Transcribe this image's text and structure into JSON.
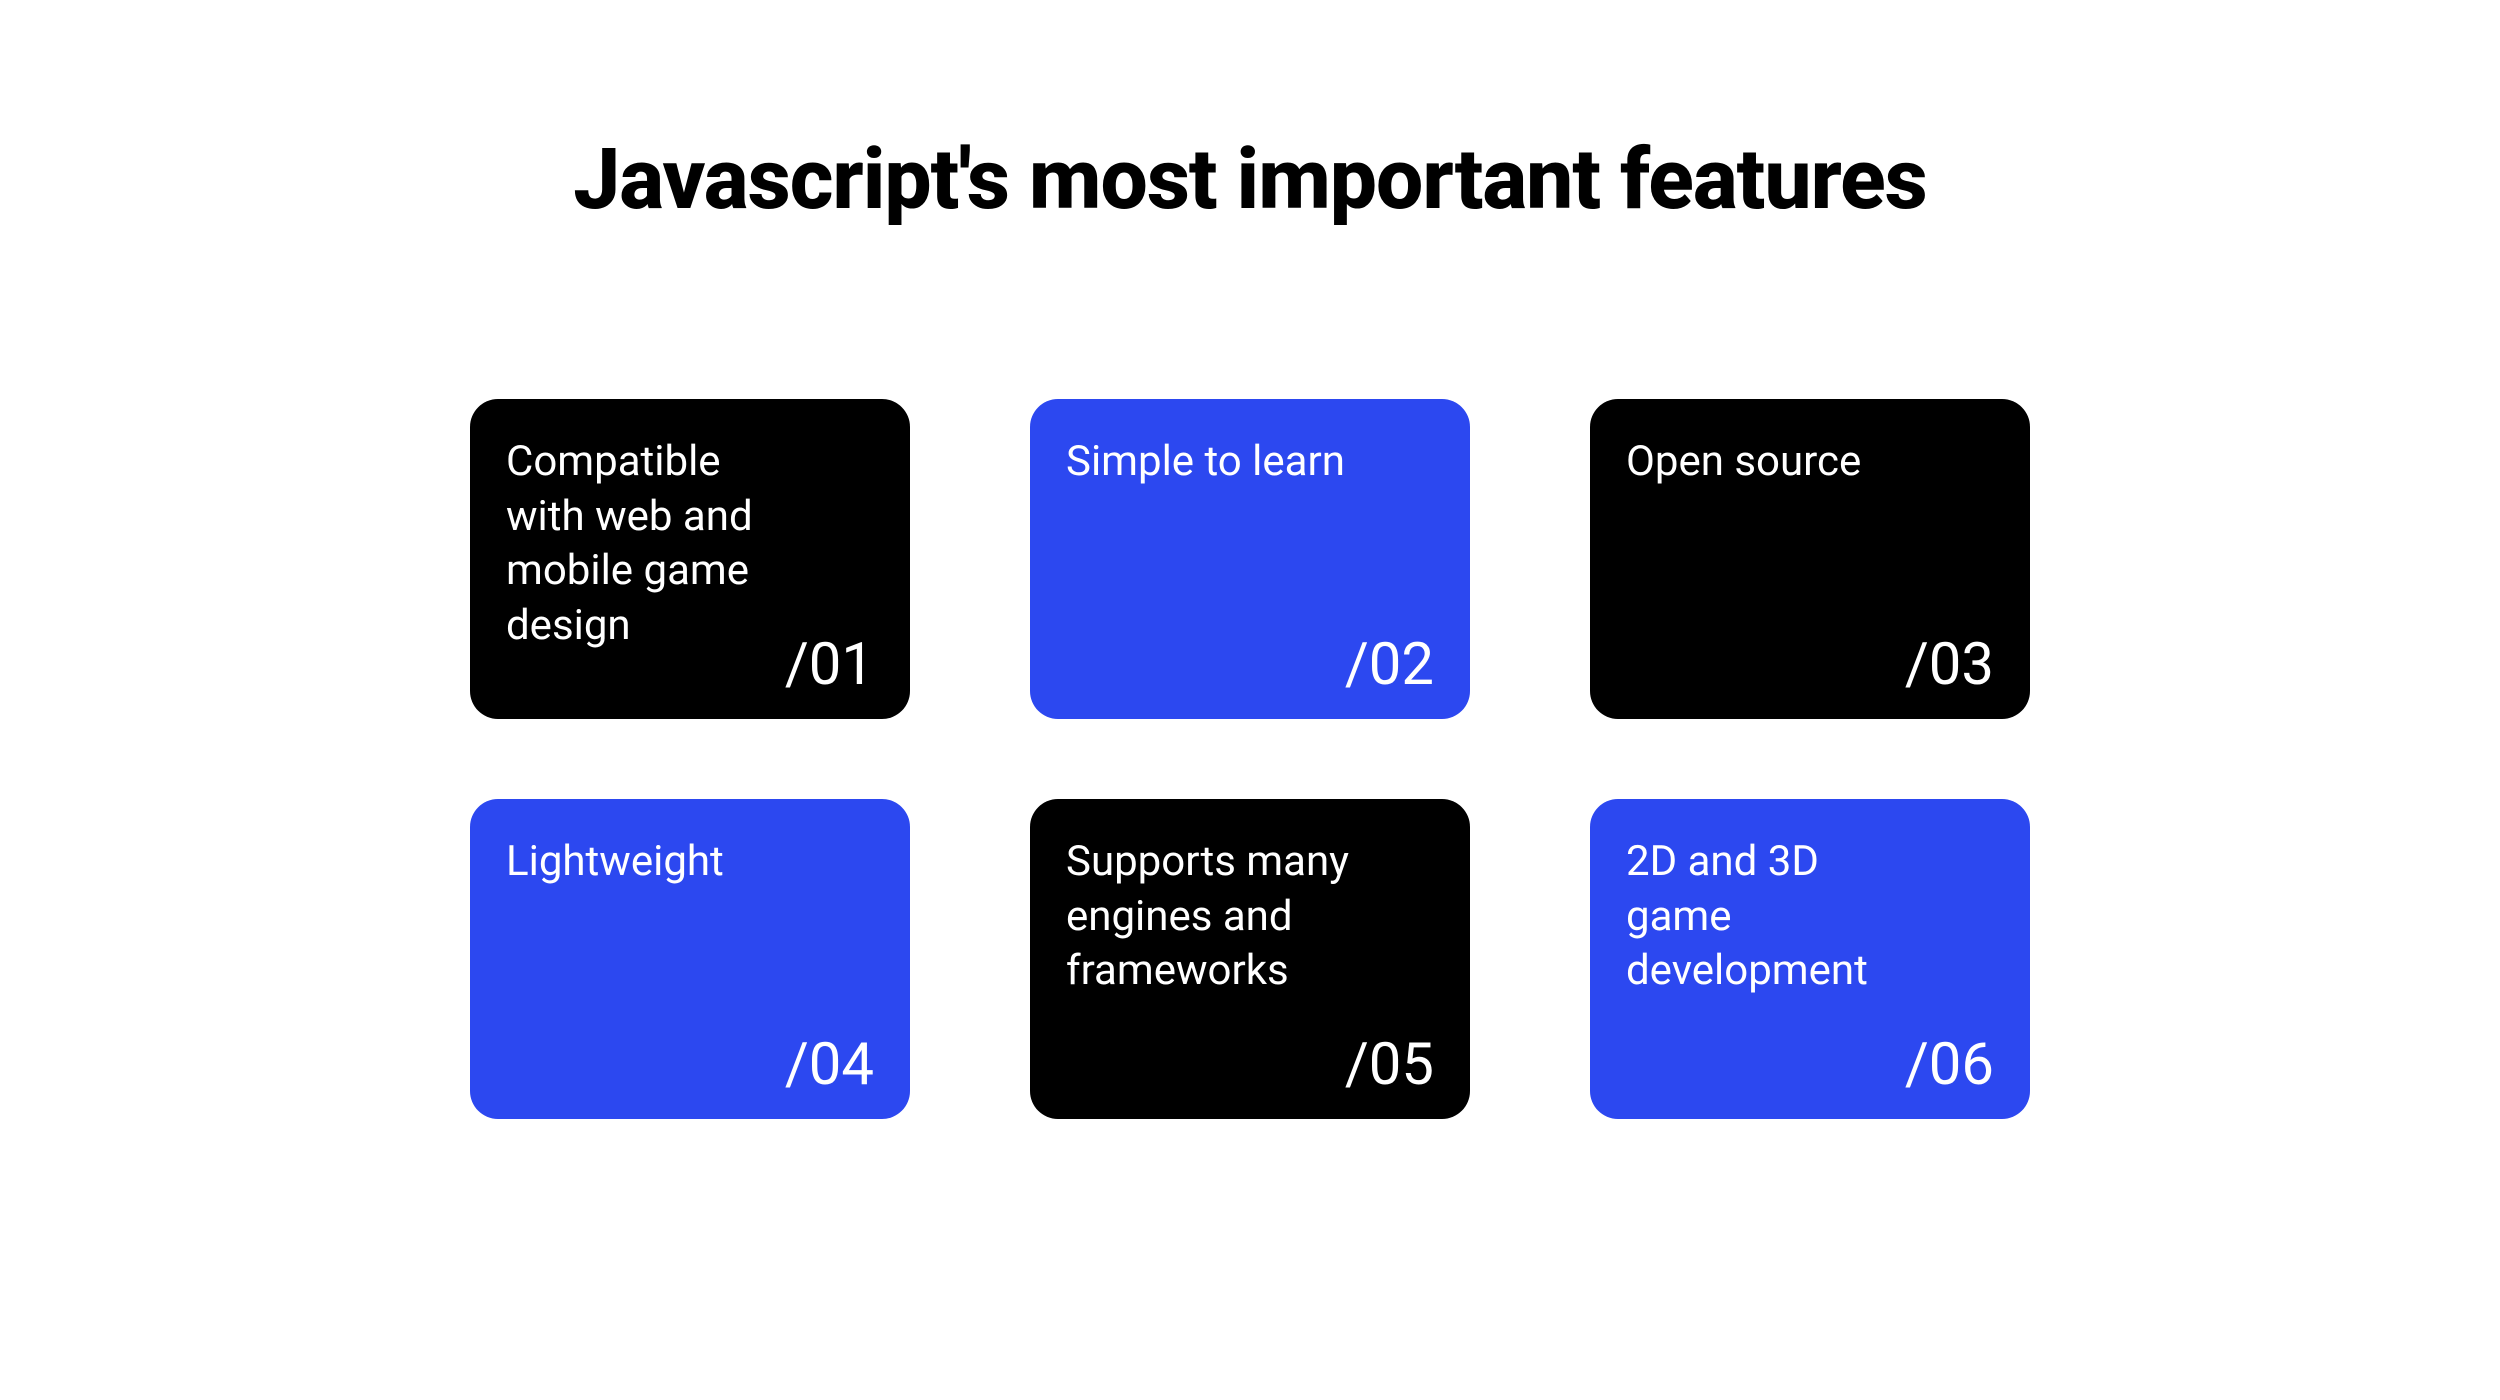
{
  "title": "Javascript's most important features",
  "colors": {
    "black": "#000000",
    "blue": "#2C48F0"
  },
  "cards": [
    {
      "text": "Compatible with web and mobile game design",
      "number": "/01",
      "variant": "black"
    },
    {
      "text": "Simple to learn",
      "number": "/02",
      "variant": "blue"
    },
    {
      "text": "Open source",
      "number": "/03",
      "variant": "black"
    },
    {
      "text": "Lightweight",
      "number": "/04",
      "variant": "blue"
    },
    {
      "text": "Supports many engines and frameworks",
      "number": "/05",
      "variant": "black"
    },
    {
      "text": "2D and 3D game development",
      "number": "/06",
      "variant": "blue"
    }
  ]
}
